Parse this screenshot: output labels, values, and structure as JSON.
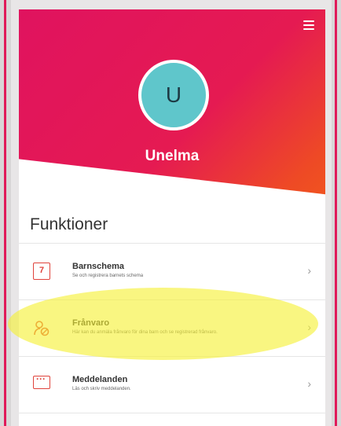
{
  "header": {
    "user_initial": "U",
    "user_name": "Unelma",
    "menu_icon": "hamburger-icon"
  },
  "section": {
    "title": "Funktioner"
  },
  "items": [
    {
      "title": "Barnschema",
      "subtitle": "Se och registrera barnets schema",
      "icon": "calendar-icon",
      "icon_text": "7",
      "chevron": "›"
    },
    {
      "title": "Frånvaro",
      "subtitle": "Här kan du anmäla frånvaro för dina barn och se registrerad frånvaro.",
      "icon": "absence-icon",
      "chevron": "›"
    },
    {
      "title": "Meddelanden",
      "subtitle": "Läs och skriv meddelanden.",
      "icon": "message-icon",
      "chevron": "›"
    }
  ],
  "colors": {
    "brand": "#e0135f",
    "accent": "#f25a1c",
    "avatar": "#5fc6cb",
    "highlight": "#f6f034"
  }
}
